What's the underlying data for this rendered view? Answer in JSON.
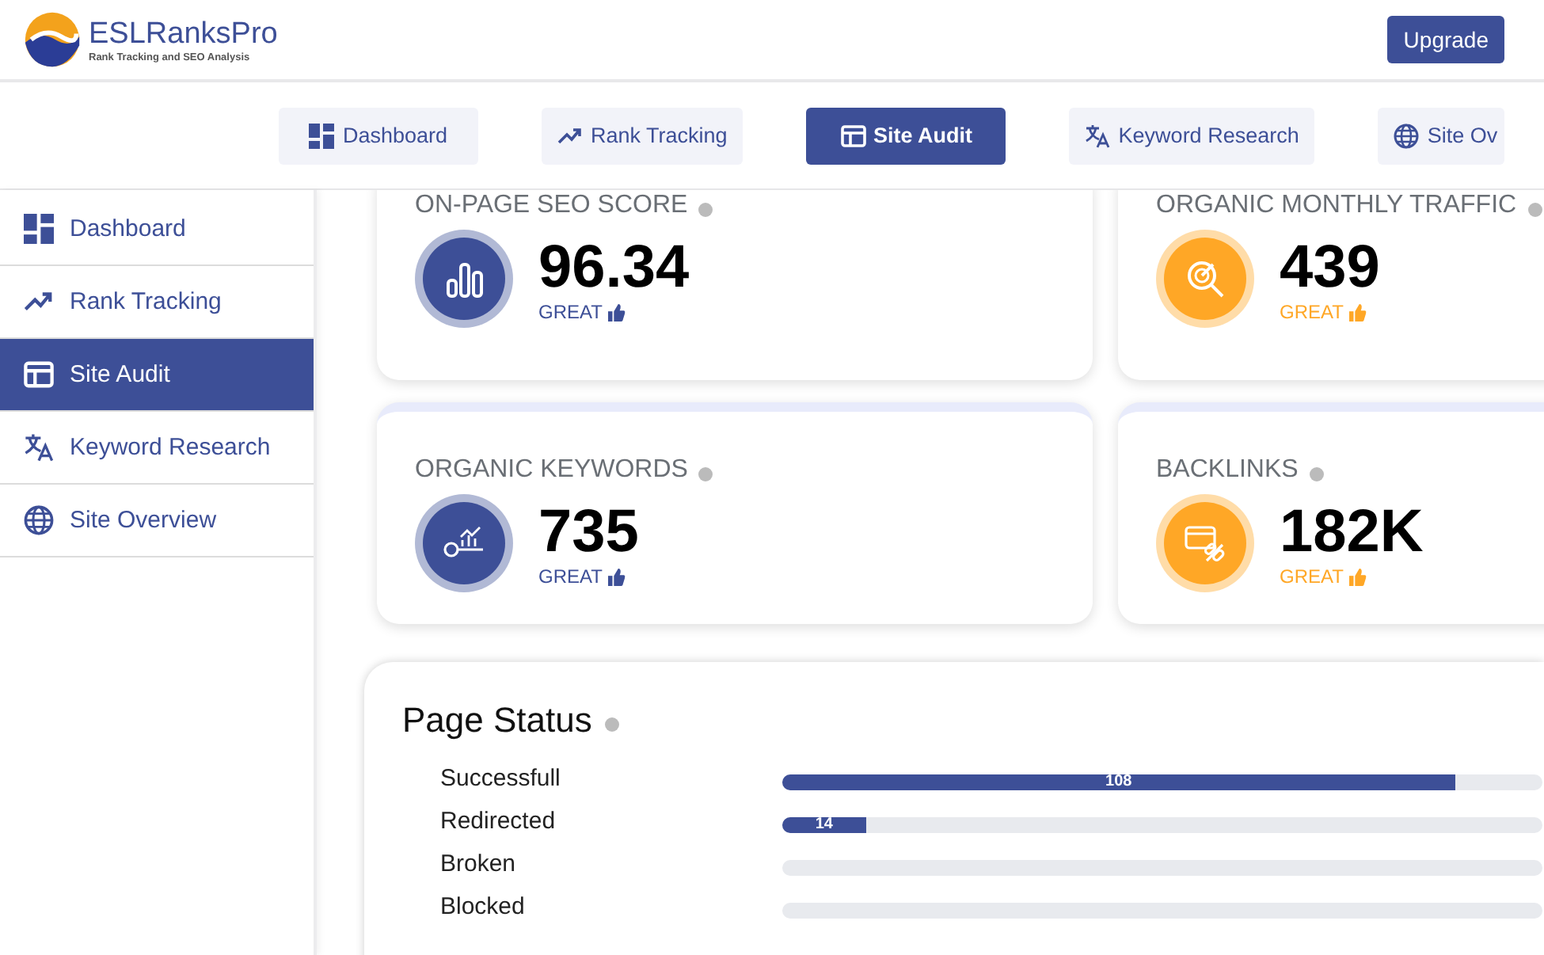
{
  "header": {
    "logo_name": "ESLRanksPro",
    "logo_tagline": "Rank Tracking and SEO Analysis",
    "upgrade_button": "Upgrade"
  },
  "top_tabs": [
    {
      "label": "Dashboard",
      "selected": false
    },
    {
      "label": "Rank Tracking",
      "selected": false
    },
    {
      "label": "Site Audit",
      "selected": true
    },
    {
      "label": "Keyword Research",
      "selected": false
    },
    {
      "label": "Site Ov",
      "selected": false
    }
  ],
  "sidebar": {
    "items": [
      {
        "label": "Dashboard",
        "selected": false
      },
      {
        "label": "Rank Tracking",
        "selected": false
      },
      {
        "label": "Site Audit",
        "selected": true
      },
      {
        "label": "Keyword Research",
        "selected": false
      },
      {
        "label": "Site Overview",
        "selected": false
      }
    ]
  },
  "metrics": [
    {
      "title": "ON-PAGE SEO SCORE",
      "value": "96.34",
      "rating": "GREAT",
      "color": "#3d4f97"
    },
    {
      "title": "ORGANIC MONTHLY TRAFFIC",
      "value": "439",
      "rating": "GREAT",
      "color": "#ffa726"
    },
    {
      "title": "ORGANIC KEYWORDS",
      "value": "735",
      "rating": "GREAT",
      "color": "#3d4f97"
    },
    {
      "title": "BACKLINKS",
      "value": "182K",
      "rating": "GREAT",
      "color": "#ffa726"
    }
  ],
  "page_status": {
    "title": "Page Status",
    "rows": [
      {
        "label": "Successfull",
        "level": 0.885,
        "reading": "108"
      },
      {
        "label": "Redirected",
        "level": 0.11,
        "reading": "14"
      },
      {
        "label": "Broken",
        "level": 0
      },
      {
        "label": "Blocked",
        "level": 0
      }
    ]
  }
}
